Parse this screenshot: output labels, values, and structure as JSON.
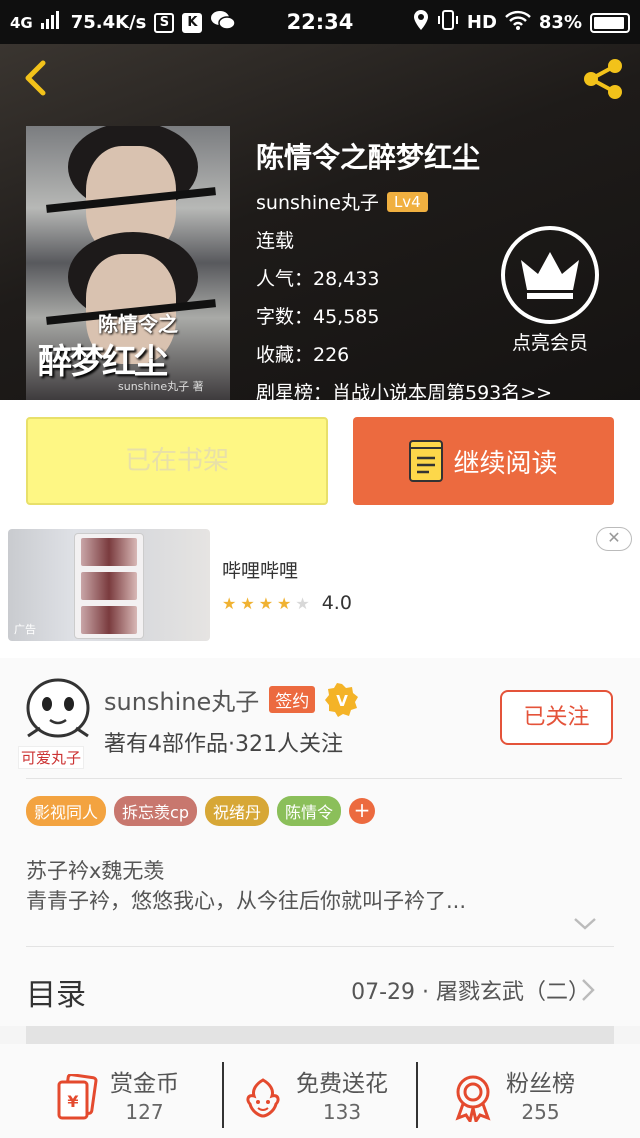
{
  "status_bar": {
    "network": "4G",
    "speed": "75.4K/s",
    "time": "22:34",
    "hd": "HD",
    "battery": "83%"
  },
  "book": {
    "cover_title": "醉梦红尘",
    "cover_subtitle": "陈情令之",
    "cover_author": "sunshine丸子 著",
    "title": "陈情令之醉梦红尘",
    "author": "sunshine丸子",
    "level": "Lv4",
    "status": "连载",
    "popularity": "人气：28,433",
    "word_count": "字数：45,585",
    "favorites": "收藏：226",
    "rank": "剧星榜：肖战小说本周第593名>>"
  },
  "vip": {
    "label": "点亮会员"
  },
  "actions": {
    "shelf_label": "已在书架",
    "read_label": "继续阅读"
  },
  "ad": {
    "tag": "广告",
    "name": "哔哩哔哩",
    "rating_value": 4.0,
    "rating": "4.0"
  },
  "author_card": {
    "avatar_label": "可爱丸子",
    "name": "sunshine丸子",
    "signed": "签约",
    "stats": "著有4部作品·321人关注",
    "follow_label": "已关注"
  },
  "tags": [
    {
      "label": "影视同人",
      "color": "#f3a340"
    },
    {
      "label": "拆忘羡cp",
      "color": "#c8776e"
    },
    {
      "label": "祝绪丹",
      "color": "#d7a736"
    },
    {
      "label": "陈情令",
      "color": "#8bbf5a"
    }
  ],
  "intro": {
    "line1": "苏子衿x魏无羡",
    "line2": "青青子衿，悠悠我心，从今往后你就叫子衿了..."
  },
  "toc": {
    "title": "目录",
    "latest": "07-29 · 屠戮玄武（二）"
  },
  "bottom_bar": {
    "reward": {
      "label": "赏金币",
      "count": "127"
    },
    "flower": {
      "label": "免费送花",
      "count": "133"
    },
    "fans": {
      "label": "粉丝榜",
      "count": "255"
    }
  },
  "colors": {
    "accent": "#ec6a3f",
    "shelf_button": "#fef784",
    "follow": "#e4533a",
    "star": "#f0b232"
  }
}
